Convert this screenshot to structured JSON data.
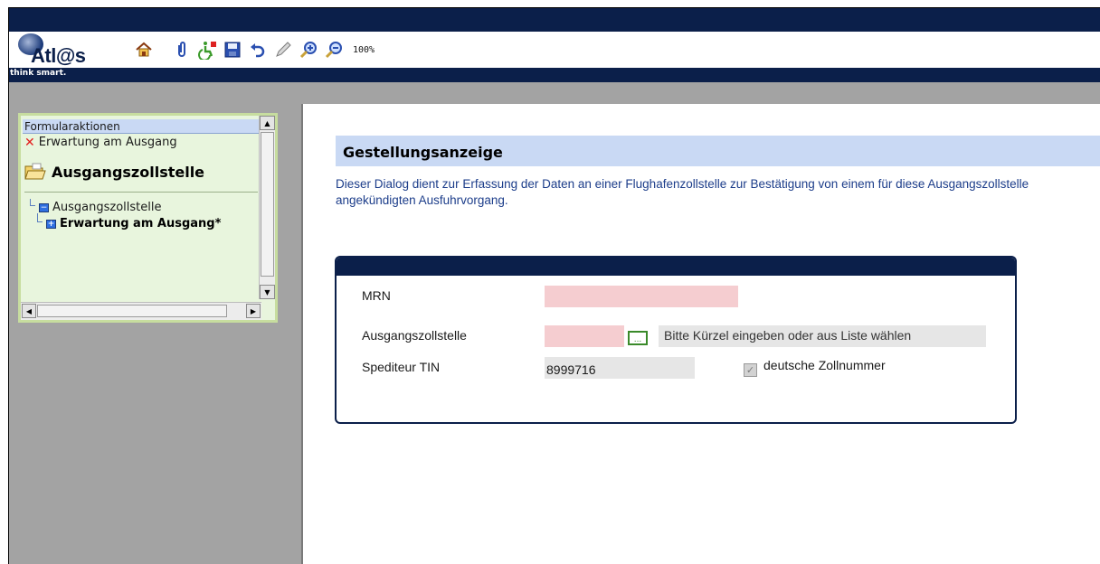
{
  "app": {
    "logo_text": "Atl@s",
    "tagline": "think smart.",
    "zoom": "100%"
  },
  "toolbar": {
    "icons": [
      "home-icon",
      "attachment-icon",
      "accessibility-icon",
      "save-icon",
      "undo-icon",
      "pencil-icon",
      "zoom-in-icon",
      "zoom-out-icon"
    ]
  },
  "nav": {
    "header": "Formularaktionen",
    "action": "Erwartung am Ausgang",
    "title": "Ausgangszollstelle",
    "tree": [
      {
        "label": "Ausgangszollstelle"
      },
      {
        "label": "Erwartung am Ausgang*"
      }
    ]
  },
  "main": {
    "heading": "Gestellungsanzeige",
    "description": "Dieser Dialog dient zur Erfassung der Daten an einer Flughafenzollstelle zur Bestätigung von einem für diese Ausgangszollstelle angekündigten Ausfuhrvorgang."
  },
  "form": {
    "mrn_label": "MRN",
    "mrn_value": "",
    "office_label": "Ausgangszollstelle",
    "office_value": "",
    "office_picker": "...",
    "office_hint": "Bitte Kürzel eingeben oder aus Liste wählen",
    "tin_label": "Spediteur TIN",
    "tin_value": "8999716",
    "checkbox_label": "deutsche Zollnummer",
    "checkbox_checked": true
  },
  "colors": {
    "navy": "#0b1f4a",
    "required_field": "#f5cdd0",
    "heading_bg": "#c9d9f4",
    "description_text": "#1c3d8a",
    "nav_bg": "#e8f5dd"
  }
}
